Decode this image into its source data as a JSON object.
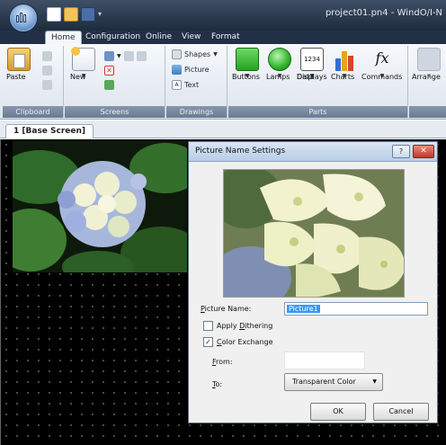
{
  "window": {
    "title": "project01.pn4 - WindO/I-N"
  },
  "ribbon_tabs": [
    {
      "label": "Home",
      "active": true
    },
    {
      "label": "Configuration"
    },
    {
      "label": "Online"
    },
    {
      "label": "View"
    },
    {
      "label": "Format"
    }
  ],
  "ribbon": {
    "clipboard": {
      "paste": "Paste",
      "group": "Clipboard"
    },
    "screens": {
      "new": "New",
      "group": "Screens"
    },
    "drawings": {
      "shapes": "Shapes",
      "picture": "Picture",
      "text": "Text",
      "group": "Drawings"
    },
    "parts": {
      "buttons": "Buttons",
      "lamps": "Lamps",
      "data_displays_1": "Data",
      "data_displays_2": "Displays",
      "data_displays_icon": "1234",
      "charts": "Charts",
      "commands": "Commands",
      "commands_icon": "fx",
      "group": "Parts"
    },
    "arrange": "Arrange"
  },
  "document_tab": "1 [Base Screen]",
  "dialog": {
    "title": "Picture Name Settings",
    "help": "?",
    "close": "✕",
    "picture_name_label_pre": "",
    "picture_name_label_u": "P",
    "picture_name_label_post": "icture Name:",
    "picture_name_value": "Picture1",
    "apply_dithering_pre": "Apply ",
    "apply_dithering_u": "D",
    "apply_dithering_post": "ithering",
    "apply_dithering_checked": false,
    "color_exchange_u": "C",
    "color_exchange_post": "olor Exchange",
    "color_exchange_checked": true,
    "from_u": "F",
    "from_post": "rom:",
    "to_u": "T",
    "to_post": "o:",
    "to_value": "Transparent Color",
    "ok": "OK",
    "cancel": "Cancel"
  },
  "colors": {
    "ribbon_dark": "#213046",
    "selection": "#3399ff",
    "canvas": "#000000"
  }
}
